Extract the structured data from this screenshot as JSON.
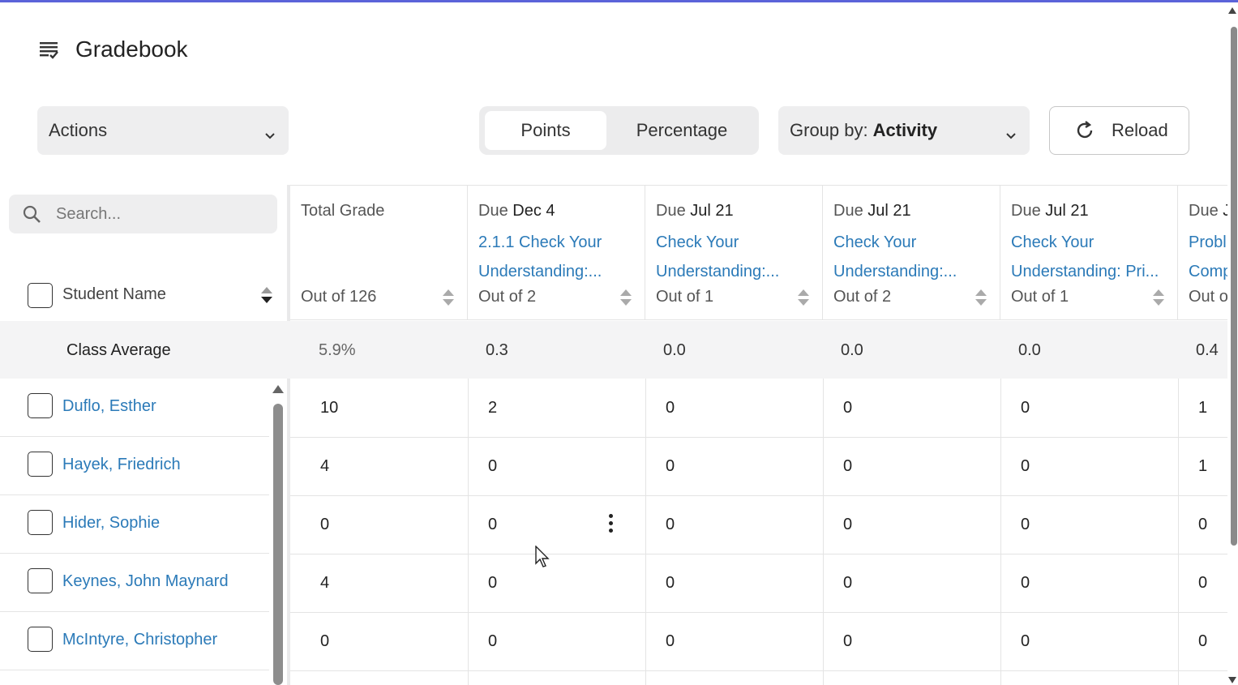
{
  "app": {
    "title": "Gradebook"
  },
  "toolbar": {
    "actions_label": "Actions",
    "view_options": [
      "Points",
      "Percentage"
    ],
    "active_view": "Points",
    "groupby_prefix": "Group by:",
    "groupby_value": "Activity",
    "reload_label": "Reload"
  },
  "search": {
    "placeholder": "Search..."
  },
  "left": {
    "student_name_header": "Student Name",
    "class_average_label": "Class Average",
    "students": [
      "Duflo, Esther",
      "Hayek, Friedrich",
      "Hider, Sophie",
      "Keynes, John Maynard",
      "McIntyre, Christopher"
    ]
  },
  "columns": [
    {
      "title": "Total Grade",
      "out_of": "Out of 126",
      "average": "5.9%"
    },
    {
      "due_prefix": "Due",
      "due_date": "Dec 4",
      "name_line1": "2.1.1 Check Your",
      "name_line2": "Understanding:...",
      "out_of": "Out of 2",
      "average": "0.3"
    },
    {
      "due_prefix": "Due",
      "due_date": "Jul 21",
      "name_line1": "Check Your",
      "name_line2": "Understanding:...",
      "out_of": "Out of 1",
      "average": "0.0"
    },
    {
      "due_prefix": "Due",
      "due_date": "Jul 21",
      "name_line1": "Check Your",
      "name_line2": "Understanding:...",
      "out_of": "Out of 2",
      "average": "0.0"
    },
    {
      "due_prefix": "Due",
      "due_date": "Jul 21",
      "name_line1": "Check Your",
      "name_line2": "Understanding: Pri...",
      "out_of": "Out of 1",
      "average": "0.0"
    },
    {
      "due_prefix": "Due",
      "due_date": "J",
      "name_line1": "Probl",
      "name_line2": "Comp",
      "out_of": "Out o",
      "average": "0.4"
    }
  ],
  "grades": [
    [
      "10",
      "2",
      "0",
      "0",
      "0",
      "1"
    ],
    [
      "4",
      "0",
      "0",
      "0",
      "0",
      "1"
    ],
    [
      "0",
      "0",
      "0",
      "0",
      "0",
      "0"
    ],
    [
      "4",
      "0",
      "0",
      "0",
      "0",
      "0"
    ],
    [
      "0",
      "0",
      "0",
      "0",
      "0",
      "0"
    ]
  ],
  "colors": {
    "accent": "#5b63d9",
    "link": "#2b7ab8",
    "surface": "#eeeeef"
  }
}
